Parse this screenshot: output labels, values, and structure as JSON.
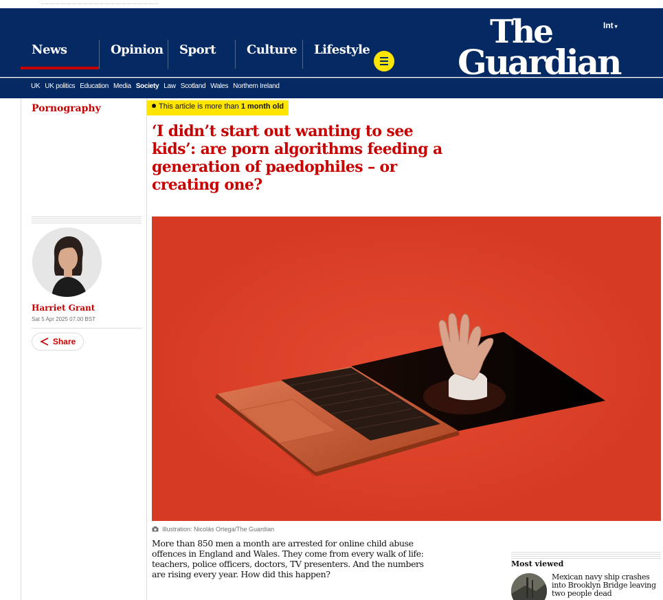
{
  "nav": {
    "edition": "Int",
    "logo_line1": "The",
    "logo_line2": "Guardian",
    "pillars": [
      "News",
      "Opinion",
      "Sport",
      "Culture",
      "Lifestyle"
    ],
    "active_pillar": "News",
    "subnav": [
      "UK",
      "UK politics",
      "Education",
      "Media",
      "Society",
      "Law",
      "Scotland",
      "Wales",
      "Northern Ireland"
    ],
    "current_subnav": "Society"
  },
  "article": {
    "section": "Pornography",
    "age_warning_prefix": "This article is more than",
    "age_warning_bold": "1 month old",
    "headline": "‘I didn’t start out wanting to see kids’: are porn algorithms feeding a generation of paedophiles – or creating one?",
    "author": "Harriet Grant",
    "date": "Sat 5 Apr 2025 07.00 BST",
    "share_label": "Share",
    "image_caption": "Illustration: Nicolás Ortega/The Guardian",
    "standfirst": "More than 850 men a month are arrested for online child abuse offences in England and Wales. They come from every walk of life: teachers, police officers, doctors, TV presenters. And the numbers are rising every year. How did this happen?"
  },
  "most_viewed": {
    "title": "Most viewed",
    "items": [
      {
        "headline": "Mexican navy ship crashes into Brooklyn Bridge leaving two people dead"
      }
    ]
  },
  "colors": {
    "brand_blue": "#052962",
    "news_red": "#c70000",
    "highlight_yellow": "#ffe500",
    "hero_red": "#d63a23"
  },
  "icons": [
    "menu-icon",
    "share-icon",
    "camera-icon"
  ]
}
